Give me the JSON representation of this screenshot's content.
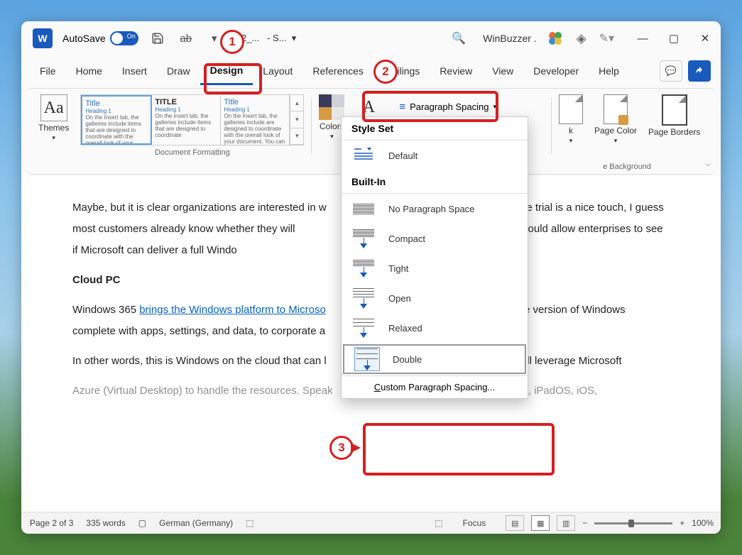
{
  "titlebar": {
    "autosave": "AutoSave",
    "on": "On",
    "doc_name": "02_...",
    "doc_status": "- S...",
    "win_title": "WinBuzzer ."
  },
  "menu": [
    "File",
    "Home",
    "Insert",
    "Draw",
    "Design",
    "Layout",
    "References",
    "Mailings",
    "Review",
    "View",
    "Developer",
    "Help"
  ],
  "active_tab": "Design",
  "ribbon": {
    "themes": "Themes",
    "doc_format": "Document Formatting",
    "colors": "Colors",
    "fonts": "Fonts",
    "paragraph_spacing": "Paragraph Spacing",
    "watermark": "k",
    "page_color": "Page Color",
    "page_borders": "Page Borders",
    "page_bg": "e Background",
    "style1": {
      "title": "Title",
      "heading": "Heading 1",
      "body": "On the Insert tab, the galleries include items that are designed to coordinate with the overall look of your document"
    },
    "style2": {
      "title": "TITLE",
      "heading": "Heading 1",
      "body": "On the Insert tab, the galleries include items that are designed to coordinate"
    },
    "style3": {
      "title": "Title",
      "heading": "Heading 1",
      "body": "On the Insert tab, the galleries include are designed to coordinate with the overall look of your document. You can"
    }
  },
  "dropdown": {
    "style_set": "Style Set",
    "default": "Default",
    "builtin": "Built-In",
    "items": [
      "No Paragraph Space",
      "Compact",
      "Tight",
      "Open",
      "Relaxed",
      "Double"
    ],
    "custom": "Custom Paragraph Spacing..."
  },
  "doc": {
    "p1a": "Maybe, but it is clear organizations are interested in w",
    "p1b": " free trial is a nice touch, I guess most customers already know whether they will",
    "p1c": "having a trail would allow enterprises to see if Microsoft can deliver a full Windo",
    "h": "Cloud PC",
    "p2a": "Windows 365 ",
    "link": "brings the Windows platform to Microso",
    "p2b": "ecure version of Windows complete with apps, settings, and data, to corporate a",
    "p3": "In other words, this is Windows on the cloud that can l",
    "p3b": "t will leverage Microsoft",
    "p4": "Azure (Virtual Desktop) to handle the resources. Speak",
    "p4b": "rts Mac, iPadOS, iOS,"
  },
  "statusbar": {
    "page": "Page 2 of 3",
    "words": "335 words",
    "lang": "German (Germany)",
    "focus": "Focus",
    "zoom": "100%"
  },
  "callouts": {
    "c1": "1",
    "c2": "2",
    "c3": "3"
  }
}
